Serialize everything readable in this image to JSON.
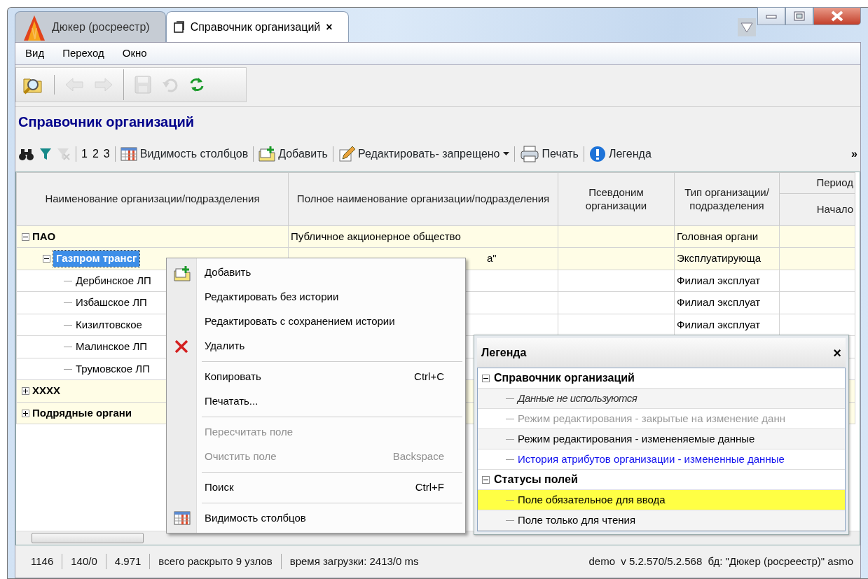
{
  "window": {
    "tabs": [
      {
        "label": "Дюкер (росреестр)",
        "selected": false
      },
      {
        "label": "Справочник организаций",
        "selected": true,
        "close": "×"
      }
    ]
  },
  "menu_bar": [
    "Вид",
    "Переход",
    "Окно"
  ],
  "main_toolbar": [
    {
      "kind": "open-folder",
      "disabled": false
    },
    {
      "kind": "separator"
    },
    {
      "kind": "back",
      "disabled": true
    },
    {
      "kind": "forward",
      "disabled": true
    },
    {
      "kind": "group"
    },
    {
      "kind": "save",
      "disabled": true
    },
    {
      "kind": "undo",
      "disabled": true
    },
    {
      "kind": "refresh",
      "disabled": false
    }
  ],
  "heading": "Справочник организаций",
  "grid_toolbar": [
    {
      "kind": "find",
      "disabled": false
    },
    {
      "kind": "filter",
      "disabled": false
    },
    {
      "kind": "filter-clear",
      "disabled": true
    },
    {
      "kind": "separator"
    },
    {
      "kind": "text",
      "label": "1"
    },
    {
      "kind": "text",
      "label": "2"
    },
    {
      "kind": "text",
      "label": "3"
    },
    {
      "kind": "separator"
    },
    {
      "kind": "columns",
      "label": "Видимость столбцов"
    },
    {
      "kind": "separator"
    },
    {
      "kind": "add",
      "label": "Добавить"
    },
    {
      "kind": "separator"
    },
    {
      "kind": "edit",
      "label": "Редактировать- запрещено",
      "dropdown": true
    },
    {
      "kind": "separator"
    },
    {
      "kind": "print",
      "label": "Печать"
    },
    {
      "kind": "separator"
    },
    {
      "kind": "info",
      "label": "Легенда"
    },
    {
      "kind": "overflow",
      "label": "»"
    }
  ],
  "grid": {
    "columns": [
      "Наименование организации/подразделения",
      "Полное наименование организации/подразделения",
      "Псевдоним организации",
      "Тип организации/ подразделения",
      {
        "group": "Период",
        "label": "Начало"
      }
    ],
    "rows": [
      {
        "name": "ПАО",
        "full_name": "Публичное акционерное общество",
        "type": "Головная органи",
        "expanded": true,
        "selected": false,
        "children": [
          {
            "name": "Газпром трансг",
            "full_name": "а\"",
            "type": "Эксплуатирующа",
            "expanded": true,
            "selected": true,
            "children": [
              {
                "name": "Дербинское ЛП",
                "type": "Филиал эксплуат",
                "selected": false
              },
              {
                "name": "Избашское ЛП",
                "type": "Филиал эксплуат",
                "selected": false
              },
              {
                "name": "Кизилтовское",
                "type": "Филиал эксплуат",
                "selected": false
              },
              {
                "name": "Малинское ЛП",
                "selected": false
              },
              {
                "name": "Трумовское ЛП",
                "selected": false
              }
            ]
          }
        ]
      },
      {
        "name": "XXXX",
        "expanded": false,
        "selected": false
      },
      {
        "name": "Подрядные органи",
        "expanded": false,
        "selected": false
      }
    ]
  },
  "context_menu": [
    {
      "kind": "item",
      "label": "Добавить",
      "disabled": false
    },
    {
      "kind": "item",
      "label": "Редактировать без истории",
      "disabled": false
    },
    {
      "kind": "item",
      "label": "Редактировать с сохранением истории",
      "disabled": false
    },
    {
      "kind": "item",
      "label": "Удалить",
      "disabled": false
    },
    {
      "kind": "separator"
    },
    {
      "kind": "item",
      "label": "Копировать",
      "shortcut": "Ctrl+C",
      "disabled": false
    },
    {
      "kind": "item",
      "label": "Печатать...",
      "disabled": false
    },
    {
      "kind": "separator"
    },
    {
      "kind": "item",
      "label": "Пересчитать поле",
      "disabled": true
    },
    {
      "kind": "item",
      "label": "Очистить поле",
      "shortcut": "Backspace",
      "disabled": true
    },
    {
      "kind": "separator"
    },
    {
      "kind": "item",
      "label": "Поиск",
      "shortcut": "Ctrl+F",
      "disabled": false
    },
    {
      "kind": "separator"
    },
    {
      "kind": "item",
      "label": "Видимость столбцов",
      "disabled": false
    }
  ],
  "legend": {
    "title": "Легенда",
    "close": "×",
    "groups": [
      {
        "label": "Справочник организаций",
        "expanded": true,
        "children": [
          {
            "label": "Данные не используются",
            "kind": "unused"
          },
          {
            "label": "Режим редактирования - закрытые на изменение данн",
            "kind": "locked"
          },
          {
            "label": "Режим редактирования - измененяемые данные",
            "kind": "editable"
          },
          {
            "label": "История атрибутов организации - измененные данные",
            "kind": "history"
          }
        ]
      },
      {
        "label": "Статусы полей",
        "expanded": true,
        "children": [
          {
            "label": "Поле обязательное для ввода",
            "kind": "required"
          },
          {
            "label": "Поле только для чтения",
            "kind": "readonly"
          }
        ]
      }
    ]
  },
  "status_bar": {
    "cells": [
      "1146",
      "140/0",
      "4.971",
      "всего раскрыто 9 узлов",
      "время загрузки: 2413/0 ms"
    ],
    "info": "demo  v 5.2.570/5.2.568  бд: \"Дюкер (росреестр)\" asmo"
  }
}
